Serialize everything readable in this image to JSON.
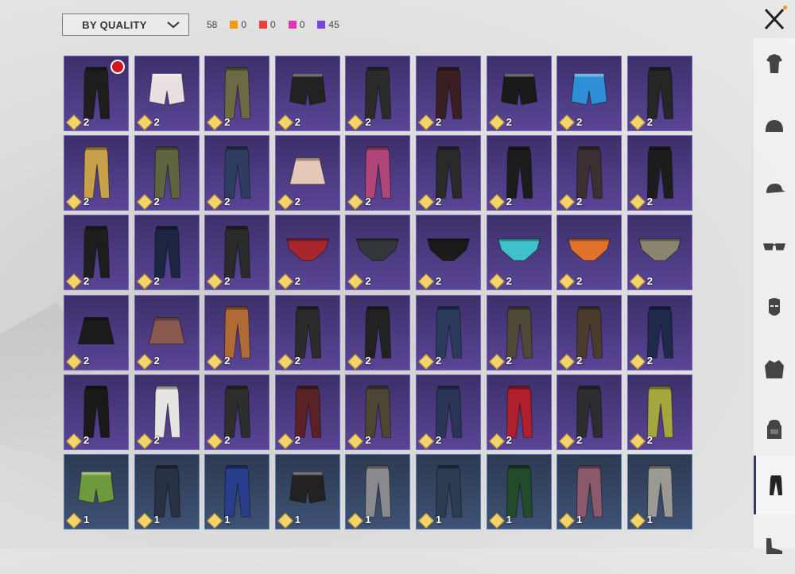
{
  "sort": {
    "selected": "BY QUALITY"
  },
  "summary": {
    "total": "58",
    "qualities": [
      {
        "color": "#f29a1a",
        "count": "0",
        "label": "legendary"
      },
      {
        "color": "#e8403a",
        "count": "0",
        "label": "mythic"
      },
      {
        "color": "#d63ab5",
        "count": "0",
        "label": "epic-pink"
      },
      {
        "color": "#7a44e0",
        "count": "45",
        "label": "epic"
      }
    ]
  },
  "close": {
    "icon": "close-icon",
    "notify_color": "#f29a1a"
  },
  "colors": {
    "epic": "#5a4596",
    "rare": "#3f5274",
    "active_tab": "#2f3b6e"
  },
  "items": [
    {
      "q": "epic",
      "c": "2",
      "garment": "pants",
      "color": "#1e1e1e",
      "badge": true
    },
    {
      "q": "epic",
      "c": "2",
      "garment": "shorts",
      "color": "#e8e0e0"
    },
    {
      "q": "epic",
      "c": "2",
      "garment": "pants",
      "color": "#6b6a44"
    },
    {
      "q": "epic",
      "c": "2",
      "garment": "shorts",
      "color": "#222222"
    },
    {
      "q": "epic",
      "c": "2",
      "garment": "pants",
      "color": "#2b2b2b"
    },
    {
      "q": "epic",
      "c": "2",
      "garment": "pants",
      "color": "#3a1f22"
    },
    {
      "q": "epic",
      "c": "2",
      "garment": "shorts",
      "color": "#1a1a1a"
    },
    {
      "q": "epic",
      "c": "2",
      "garment": "shorts",
      "color": "#2f8fd6"
    },
    {
      "q": "epic",
      "c": "2",
      "garment": "pants",
      "color": "#262626"
    },
    {
      "q": "epic",
      "c": "2",
      "garment": "pants",
      "color": "#c8a04a"
    },
    {
      "q": "epic",
      "c": "2",
      "garment": "pants",
      "color": "#5e6540"
    },
    {
      "q": "epic",
      "c": "2",
      "garment": "pants",
      "color": "#2f3d62"
    },
    {
      "q": "epic",
      "c": "2",
      "garment": "skirt",
      "color": "#e6c8b8"
    },
    {
      "q": "epic",
      "c": "2",
      "garment": "pants",
      "color": "#b0457a"
    },
    {
      "q": "epic",
      "c": "2",
      "garment": "pants",
      "color": "#2a2a2a"
    },
    {
      "q": "epic",
      "c": "2",
      "garment": "pants",
      "color": "#1c1c1c"
    },
    {
      "q": "epic",
      "c": "2",
      "garment": "pants",
      "color": "#3c3033"
    },
    {
      "q": "epic",
      "c": "2",
      "garment": "pants",
      "color": "#1d1d1d"
    },
    {
      "q": "epic",
      "c": "2",
      "garment": "pants",
      "color": "#1e1e1e"
    },
    {
      "q": "epic",
      "c": "2",
      "garment": "pants",
      "color": "#1d2640"
    },
    {
      "q": "epic",
      "c": "2",
      "garment": "pants",
      "color": "#2a2a2a"
    },
    {
      "q": "epic",
      "c": "2",
      "garment": "briefs",
      "color": "#a8262e"
    },
    {
      "q": "epic",
      "c": "2",
      "garment": "briefs",
      "color": "#33363a"
    },
    {
      "q": "epic",
      "c": "2",
      "garment": "briefs",
      "color": "#1b1b1b"
    },
    {
      "q": "epic",
      "c": "2",
      "garment": "briefs",
      "color": "#3fc2c9"
    },
    {
      "q": "epic",
      "c": "2",
      "garment": "briefs",
      "color": "#e0722a"
    },
    {
      "q": "epic",
      "c": "2",
      "garment": "briefs",
      "color": "#8a8570"
    },
    {
      "q": "epic",
      "c": "2",
      "garment": "skirt",
      "color": "#1c1c1c"
    },
    {
      "q": "epic",
      "c": "2",
      "garment": "skirt",
      "color": "#8a5a50"
    },
    {
      "q": "epic",
      "c": "2",
      "garment": "pants",
      "color": "#b06a35"
    },
    {
      "q": "epic",
      "c": "2",
      "garment": "pants",
      "color": "#2b2b2b"
    },
    {
      "q": "epic",
      "c": "2",
      "garment": "pants",
      "color": "#222222"
    },
    {
      "q": "epic",
      "c": "2",
      "garment": "pants",
      "color": "#2c3a5e"
    },
    {
      "q": "epic",
      "c": "2",
      "garment": "pants",
      "color": "#4f4a38"
    },
    {
      "q": "epic",
      "c": "2",
      "garment": "pants",
      "color": "#4b3c2e"
    },
    {
      "q": "epic",
      "c": "2",
      "garment": "pants",
      "color": "#1f2a4a"
    },
    {
      "q": "epic",
      "c": "2",
      "garment": "pants",
      "color": "#1a1a1a"
    },
    {
      "q": "epic",
      "c": "2",
      "garment": "pants",
      "color": "#e4e4e0"
    },
    {
      "q": "epic",
      "c": "2",
      "garment": "pants",
      "color": "#2e2e2e"
    },
    {
      "q": "epic",
      "c": "2",
      "garment": "pants",
      "color": "#5a2226"
    },
    {
      "q": "epic",
      "c": "2",
      "garment": "pants",
      "color": "#4e4634"
    },
    {
      "q": "epic",
      "c": "2",
      "garment": "pants",
      "color": "#2a3558"
    },
    {
      "q": "epic",
      "c": "2",
      "garment": "pants",
      "color": "#b0202c"
    },
    {
      "q": "epic",
      "c": "2",
      "garment": "pants",
      "color": "#2d2d30"
    },
    {
      "q": "epic",
      "c": "2",
      "garment": "pants",
      "color": "#a4a63e"
    },
    {
      "q": "rare",
      "c": "1",
      "garment": "shorts",
      "color": "#6d9a3a"
    },
    {
      "q": "rare",
      "c": "1",
      "garment": "pants",
      "color": "#283244"
    },
    {
      "q": "rare",
      "c": "1",
      "garment": "pants",
      "color": "#2a3f8c"
    },
    {
      "q": "rare",
      "c": "1",
      "garment": "shorts",
      "color": "#222222"
    },
    {
      "q": "rare",
      "c": "1",
      "garment": "pants",
      "color": "#8a8a8e"
    },
    {
      "q": "rare",
      "c": "1",
      "garment": "pants",
      "color": "#2e3c52"
    },
    {
      "q": "rare",
      "c": "1",
      "garment": "pants",
      "color": "#244a2c"
    },
    {
      "q": "rare",
      "c": "1",
      "garment": "pants",
      "color": "#8a5a6c"
    },
    {
      "q": "rare",
      "c": "1",
      "garment": "pants",
      "color": "#9a9a92"
    }
  ],
  "sidebar": [
    {
      "icon": "outfit-icon"
    },
    {
      "icon": "helmet-icon"
    },
    {
      "icon": "cap-icon"
    },
    {
      "icon": "glasses-icon"
    },
    {
      "icon": "mask-icon"
    },
    {
      "icon": "jacket-icon"
    },
    {
      "icon": "backpack-icon"
    },
    {
      "icon": "pants-icon",
      "active": true
    },
    {
      "icon": "shoes-icon"
    }
  ]
}
